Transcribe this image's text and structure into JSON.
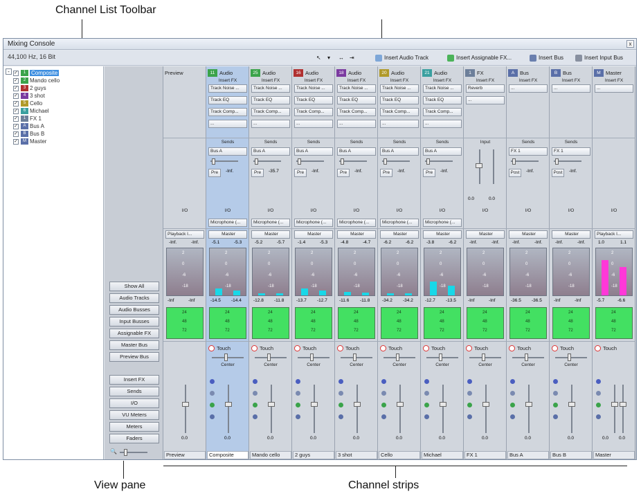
{
  "annotations": {
    "toolbar": "Channel List  Toolbar",
    "view_pane": "View pane",
    "strips": "Channel strips"
  },
  "window": {
    "title": "Mixing Console",
    "close": "x"
  },
  "toolbar": {
    "sample_rate": "44,100 Hz, 16 Bit",
    "insert_audio": "Insert Audio Track",
    "insert_fx": "Insert Assignable FX...",
    "insert_bus": "Insert Bus",
    "insert_input_bus": "Insert Input Bus"
  },
  "channel_list": [
    {
      "label": "Composite",
      "num": "1",
      "color": "#3aa34a",
      "selected": true
    },
    {
      "label": "Mando cello",
      "num": "2",
      "color": "#3aa34a"
    },
    {
      "label": "2 guys",
      "num": "3",
      "color": "#b03030"
    },
    {
      "label": "3 shot",
      "num": "4",
      "color": "#7b3aa0"
    },
    {
      "label": "Cello",
      "num": "5",
      "color": "#b09a2a"
    },
    {
      "label": "Michael",
      "num": "6",
      "color": "#3aa0a0"
    },
    {
      "label": "FX 1",
      "num": "1",
      "color": "#6d7f9a"
    },
    {
      "label": "Bus A",
      "num": "A",
      "color": "#5a6fa8"
    },
    {
      "label": "Bus B",
      "num": "B",
      "color": "#5a6fa8"
    },
    {
      "label": "Master",
      "num": "M",
      "color": "#5a6fa8"
    }
  ],
  "view_buttons": [
    "Show All",
    "Audio Tracks",
    "Audio Busses",
    "Input Busses",
    "Assignable FX",
    "Master Bus",
    "Preview Bus",
    "Insert FX",
    "Sends",
    "I/O",
    "VU Meters",
    "Meters",
    "Faders"
  ],
  "strips": [
    {
      "type": "preview",
      "header": "Preview",
      "io": "I/O",
      "playback": "Playback I...",
      "db_top": [
        "-Inf.",
        "-Inf."
      ],
      "db_bottom": [
        "-Inf",
        "-Inf"
      ],
      "fader_val": "0.0",
      "name": "Preview"
    },
    {
      "type": "audio",
      "num": "11",
      "num_color": "#3aa34a",
      "header": "Audio",
      "insert": "Insert FX",
      "fx": [
        "Track Noise ...",
        "Track EQ",
        "Track Comp...",
        "..."
      ],
      "sends_label": "Sends",
      "send_bus": "Bus A",
      "prepost": "Pre",
      "send_val": "-Inf.",
      "io": "I/O",
      "input": "Microphone (...",
      "route": "Master",
      "db_top": [
        "-5.1",
        "-5.3"
      ],
      "db_bottom": [
        "-14.5",
        "-14.4"
      ],
      "touch": "Touch",
      "pan": "Center",
      "fader_val": "0.0",
      "name": "Composite",
      "sel": true
    },
    {
      "type": "audio",
      "num": "25",
      "num_color": "#3aa34a",
      "header": "Audio",
      "insert": "Insert FX",
      "fx": [
        "Track Noise ...",
        "Track EQ",
        "Track Comp...",
        "..."
      ],
      "sends_label": "Sends",
      "send_bus": "Bus A",
      "prepost": "Pre",
      "send_val": "-35.7",
      "io": "I/O",
      "input": "Microphone (...",
      "route": "Master",
      "db_top": [
        "-5.2",
        "-5.7"
      ],
      "db_bottom": [
        "-12.8",
        "-11.8"
      ],
      "touch": "Touch",
      "pan": "Center",
      "fader_val": "0.0",
      "name": "Mando cello"
    },
    {
      "type": "audio",
      "num": "16",
      "num_color": "#b03030",
      "header": "Audio",
      "insert": "Insert FX",
      "fx": [
        "Track Noise ...",
        "Track EQ",
        "Track Comp...",
        "..."
      ],
      "sends_label": "Sends",
      "send_bus": "Bus A",
      "prepost": "Pre",
      "send_val": "-Inf.",
      "io": "I/O",
      "input": "Microphone (...",
      "route": "Master",
      "db_top": [
        "-1.4",
        "-5.3"
      ],
      "db_bottom": [
        "-13.7",
        "-12.7"
      ],
      "touch": "Touch",
      "pan": "Center",
      "fader_val": "0.0",
      "name": "2 guys"
    },
    {
      "type": "audio",
      "num": "18",
      "num_color": "#7b3aa0",
      "header": "Audio",
      "insert": "Insert FX",
      "fx": [
        "Track Noise ...",
        "Track EQ",
        "Track Comp...",
        "..."
      ],
      "sends_label": "Sends",
      "send_bus": "Bus A",
      "prepost": "Pre",
      "send_val": "-Inf.",
      "io": "I/O",
      "input": "Microphone (...",
      "route": "Master",
      "db_top": [
        "-4.8",
        "-4.7"
      ],
      "db_bottom": [
        "-11.6",
        "-11.8"
      ],
      "touch": "Touch",
      "pan": "Center",
      "fader_val": "0.0",
      "name": "3 shot"
    },
    {
      "type": "audio",
      "num": "20",
      "num_color": "#b09a2a",
      "header": "Audio",
      "insert": "Insert FX",
      "fx": [
        "Track Noise ...",
        "Track EQ",
        "Track Comp...",
        "..."
      ],
      "sends_label": "Sends",
      "send_bus": "Bus A",
      "prepost": "Pre",
      "send_val": "-Inf.",
      "io": "I/O",
      "input": "Microphone (...",
      "route": "Master",
      "db_top": [
        "-6.2",
        "-6.2"
      ],
      "db_bottom": [
        "-34.2",
        "-34.2"
      ],
      "touch": "Touch",
      "pan": "Center",
      "fader_val": "0.0",
      "name": "Cello"
    },
    {
      "type": "audio",
      "num": "21",
      "num_color": "#3aa0a0",
      "header": "Audio",
      "insert": "Insert FX",
      "fx": [
        "Track Noise ...",
        "Track EQ",
        "Track Comp...",
        "..."
      ],
      "sends_label": "Sends",
      "send_bus": "Bus A",
      "prepost": "Pre",
      "send_val": "-Inf.",
      "io": "I/O",
      "input": "Microphone (...",
      "route": "Master",
      "db_top": [
        "-3.8",
        "-6.2"
      ],
      "db_bottom": [
        "-12.7",
        "-13.5"
      ],
      "touch": "Touch",
      "pan": "Center",
      "fader_val": "0.0",
      "name": "Michael"
    },
    {
      "type": "fx",
      "num": "1",
      "num_color": "#6d7f9a",
      "header": "FX",
      "insert": "Insert FX",
      "fx": [
        "Reverb",
        "..."
      ],
      "sends_label": "Input",
      "input_vals": [
        "0.0",
        "0.0"
      ],
      "io": "I/O",
      "route": "Master",
      "db_top": [
        "-Inf.",
        "-Inf."
      ],
      "db_bottom": [
        "-Inf",
        "-Inf"
      ],
      "touch": "Touch",
      "pan": "Center",
      "fader_val": "0.0",
      "name": "FX 1"
    },
    {
      "type": "bus",
      "num": "A",
      "num_color": "#5a6fa8",
      "header": "Bus",
      "insert": "Insert FX",
      "fx": [
        "..."
      ],
      "sends_label": "Sends",
      "send_bus": "FX 1",
      "prepost": "Post",
      "send_val": "-Inf.",
      "io": "I/O",
      "route": "Master",
      "db_top": [
        "-Inf.",
        "-Inf."
      ],
      "db_bottom": [
        "-36.5",
        "-36.5"
      ],
      "touch": "Touch",
      "pan": "Center",
      "fader_val": "0.0",
      "name": "Bus A"
    },
    {
      "type": "bus",
      "num": "B",
      "num_color": "#5a6fa8",
      "header": "Bus",
      "insert": "Insert FX",
      "fx": [
        "..."
      ],
      "sends_label": "Sends",
      "send_bus": "FX 1",
      "prepost": "Post",
      "send_val": "-Inf.",
      "io": "I/O",
      "route": "Master",
      "db_top": [
        "-Inf.",
        "-Inf."
      ],
      "db_bottom": [
        "-Inf",
        "-Inf"
      ],
      "touch": "Touch",
      "pan": "Center",
      "fader_val": "0.0",
      "name": "Bus B"
    },
    {
      "type": "master",
      "num": "M",
      "num_color": "#5a6fa8",
      "header": "Master",
      "insert": "Insert FX",
      "fx": [
        "..."
      ],
      "io": "I/O",
      "playback": "Playback I...",
      "db_top": [
        "1.0",
        "1.1"
      ],
      "db_bottom": [
        "-5.7",
        "-6.6"
      ],
      "touch": "Touch",
      "fader_val": "0.0",
      "fader_val2": "0.0",
      "name": "Master"
    }
  ],
  "meter_scale": [
    "2",
    "0",
    "-6",
    "-18",
    "24",
    "48",
    "72"
  ],
  "levels": [
    [
      0,
      0
    ],
    [
      0.14,
      0.1
    ],
    [
      0.04,
      0.04
    ],
    [
      0.14,
      0.1
    ],
    [
      0.08,
      0.06
    ],
    [
      0.04,
      0.04
    ],
    [
      0.3,
      0.2
    ],
    [
      0,
      0
    ],
    [
      0,
      0
    ],
    [
      0,
      0
    ],
    [
      0.75,
      0.6
    ]
  ],
  "colors": {
    "selected": "#b5cbe8",
    "meter_green": "#43e062",
    "meter_cyan": "#18d8e8",
    "meter_magenta": "#ff38d8"
  }
}
